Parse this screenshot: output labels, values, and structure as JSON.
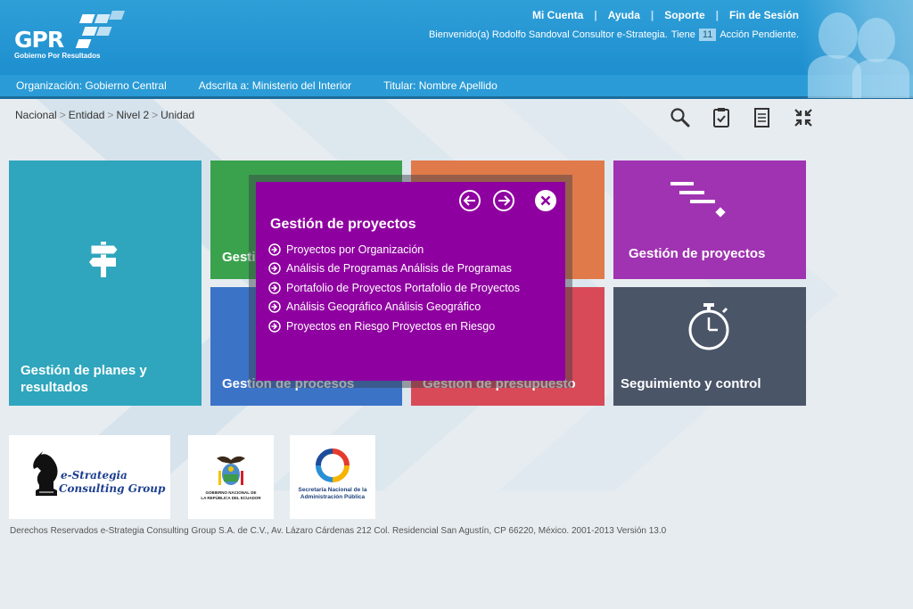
{
  "header": {
    "logo_text": "GPR",
    "logo_subtitle": "Gobierno Por Resultados",
    "links": [
      "Mi Cuenta",
      "Ayuda",
      "Soporte",
      "Fin de Sesión"
    ],
    "welcome_prefix": "Bienvenido(a) Rodolfo Sandoval Consultor e-Strategia.",
    "pending_prefix": "Tiene",
    "pending_count": "11",
    "pending_suffix": "Acción Pendiente."
  },
  "orgbar": {
    "organizacion": "Organización: Gobierno Central",
    "adscrita": "Adscrita a: Ministerio del Interior",
    "titular": "Titular: Nombre Apellido"
  },
  "breadcrumb": [
    "Nacional",
    "Entidad",
    "Nivel 2",
    "Unidad"
  ],
  "tools": [
    "search-icon",
    "clipboard-check-icon",
    "document-icon",
    "collapse-icon"
  ],
  "tiles": {
    "planes": "Gestión de planes y resultados",
    "green_partial": "Gesti",
    "proyectos": "Gestión de proyectos",
    "procesos": "Gestión de procesos",
    "presupuesto": "Gestión de presupuesto",
    "seguimiento": "Seguimiento y control"
  },
  "modal": {
    "title": "Gestión de proyectos",
    "items": [
      "Proyectos por Organización",
      "Análisis de Programas Análisis de Programas",
      "Portafolio de Proyectos Portafolio de Proyectos",
      "Análisis Geográfico Análisis Geográfico",
      "Proyectos en Riesgo Proyectos en Riesgo"
    ]
  },
  "footer": {
    "estrategia_line1": "e-Strategia",
    "estrategia_line2": "Consulting Group",
    "ecuador_line1": "GOBIERNO NACIONAL DE",
    "ecuador_line2": "LA REPÚBLICA DEL ECUADOR",
    "senplades_line1": "Secretaría Nacional de la",
    "senplades_line2": "Administración Pública",
    "copyright": "Derechos Reservados e-Strategia Consulting Group S.A. de C.V., Av. Lázaro Cárdenas 212 Col. Residencial San Agustín, CP 66220, México. 2001-2013 Versión 13.0"
  },
  "colors": {
    "header": "#2f9fd8",
    "planes": "#2fa6bd",
    "green": "#3aa24c",
    "orange": "#e07a4a",
    "proyectos": "#a033b1",
    "procesos": "#3b73c7",
    "presupuesto": "#d84a58",
    "seguimiento": "#4a5568",
    "modal": "#8f00a0"
  }
}
